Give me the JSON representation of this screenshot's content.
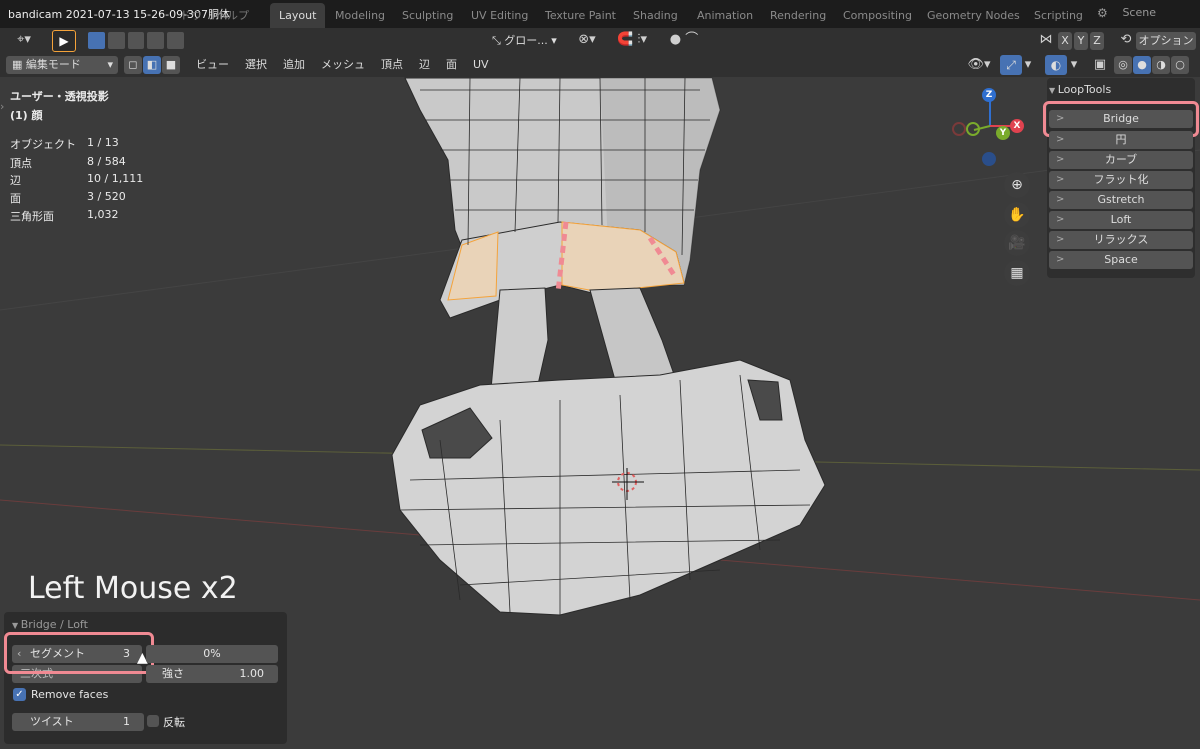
{
  "window": {
    "title": "bandicam 2021-07-13 15-26-09-307胴体"
  },
  "menu": {
    "items": [
      "ドウ",
      "ヘルプ"
    ]
  },
  "workspace_tabs": [
    "Layout",
    "Modeling",
    "Sculpting",
    "UV Editing",
    "Texture Paint",
    "Shading",
    "Animation",
    "Rendering",
    "Compositing",
    "Geometry Nodes",
    "Scripting"
  ],
  "scene": {
    "label": "Scene"
  },
  "header1": {
    "transform_orientation": "グロー...",
    "axes": [
      "X",
      "Y",
      "Z"
    ],
    "options_label": "オプション"
  },
  "header2": {
    "mode": "編集モード",
    "menus": [
      "ビュー",
      "選択",
      "追加",
      "メッシュ",
      "頂点",
      "辺",
      "面",
      "UV"
    ]
  },
  "overlay": {
    "view_name": "ユーザー・透視投影",
    "object_name": "(1) 顔",
    "stats": [
      {
        "label": "オブジェクト",
        "value": "1 / 13"
      },
      {
        "label": "頂点",
        "value": "8 / 584"
      },
      {
        "label": "辺",
        "value": "10 / 1,111"
      },
      {
        "label": "面",
        "value": "3 / 520"
      },
      {
        "label": "三角形面",
        "value": "1,032"
      }
    ]
  },
  "gizmo": {
    "x": "X",
    "y": "Y",
    "z": "Z"
  },
  "looptools": {
    "title": "LoopTools",
    "items": [
      "Bridge",
      "円",
      "カーブ",
      "フラット化",
      "Gstretch",
      "Loft",
      "リラックス",
      "Space"
    ]
  },
  "caption": "Left Mouse x2",
  "operator_panel": {
    "title": "Bridge / Loft",
    "segments_label": "セグメント",
    "segments_value": "3",
    "percent_value": "0%",
    "interpolation_label": "三次式",
    "strength_label": "強さ",
    "strength_value": "1.00",
    "remove_faces_label": "Remove faces",
    "remove_faces_checked": true,
    "twist_label": "ツイスト",
    "twist_value": "1",
    "reverse_label": "反転"
  },
  "colors": {
    "highlight": "#f08a93",
    "selection": "#f5a33a",
    "gizmo_x": "#e0424f",
    "gizmo_y": "#7aab2c",
    "gizmo_z": "#2f6fd0"
  }
}
